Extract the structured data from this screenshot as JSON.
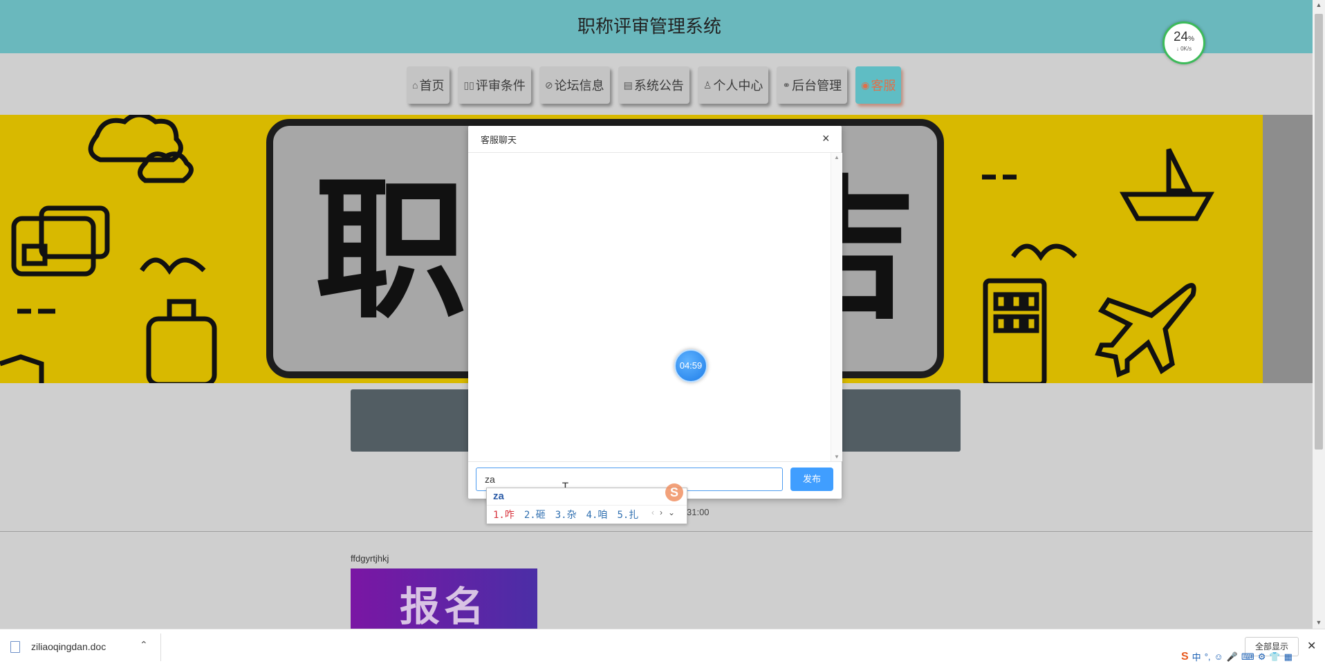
{
  "header": {
    "title": "职称评审管理系统"
  },
  "nav": {
    "items": [
      {
        "label": "首页",
        "icon": "home-icon",
        "glyph": "⌂"
      },
      {
        "label": "评审条件",
        "icon": "grid-icon",
        "glyph": "▯▯"
      },
      {
        "label": "论坛信息",
        "icon": "tag-icon",
        "glyph": "⊘"
      },
      {
        "label": "系统公告",
        "icon": "clipboard-icon",
        "glyph": "▤"
      },
      {
        "label": "个人中心",
        "icon": "user-icon",
        "glyph": "♙"
      },
      {
        "label": "后台管理",
        "icon": "link-icon",
        "glyph": "⚭"
      },
      {
        "label": "客服",
        "icon": "headset-icon",
        "glyph": "◉"
      }
    ],
    "active_index": 6
  },
  "banner": {
    "chars": [
      "职",
      "吉"
    ]
  },
  "speed_widget": {
    "percent": "24",
    "percent_sign": "%",
    "rate": "↓ 0K/s"
  },
  "modal": {
    "title": "客服聊天",
    "close": "×",
    "timer": "04:59",
    "input_value": "za",
    "publish_label": "发布"
  },
  "ime": {
    "pinyin": "za",
    "logo": "S",
    "candidates": [
      "1.咋",
      "2.砸",
      "3.杂",
      "4.咱",
      "5.扎"
    ],
    "arrows": [
      "‹",
      "›",
      "⌄"
    ]
  },
  "page": {
    "timestamp": "31:00",
    "post_title": "ffdgyrtjhkj",
    "promo_text": "报名"
  },
  "download_bar": {
    "file_name": "ziliaoqingdan.doc",
    "show_all": "全部显示",
    "close": "✕",
    "chevron": "⌃"
  },
  "tray": {
    "items": [
      "S",
      "中",
      "°,",
      "☺",
      "🎤",
      "⌨",
      "⚙",
      "👕",
      "▦"
    ]
  }
}
